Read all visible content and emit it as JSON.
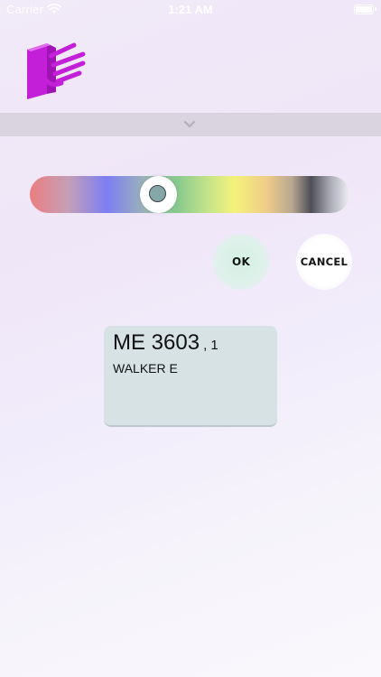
{
  "status_bar": {
    "carrier": "Carrier",
    "time": "1:21 AM",
    "icons": [
      "wifi-icon",
      "battery-icon"
    ]
  },
  "header": {
    "logo_icon": "book-hand-logo-icon",
    "logo_color": "#c41fd8"
  },
  "collapse_bar": {
    "icon": "chevron-down-icon",
    "color": "#d9d4df"
  },
  "color_picker": {
    "selected_color": "#85a7a8",
    "thumb_position": 0.39
  },
  "actions": {
    "ok_label": "OK",
    "cancel_label": "CANCEL"
  },
  "card": {
    "code": "ME 3603",
    "sub": ", 1",
    "name": "WALKER E",
    "background": "#d6e2e4"
  }
}
